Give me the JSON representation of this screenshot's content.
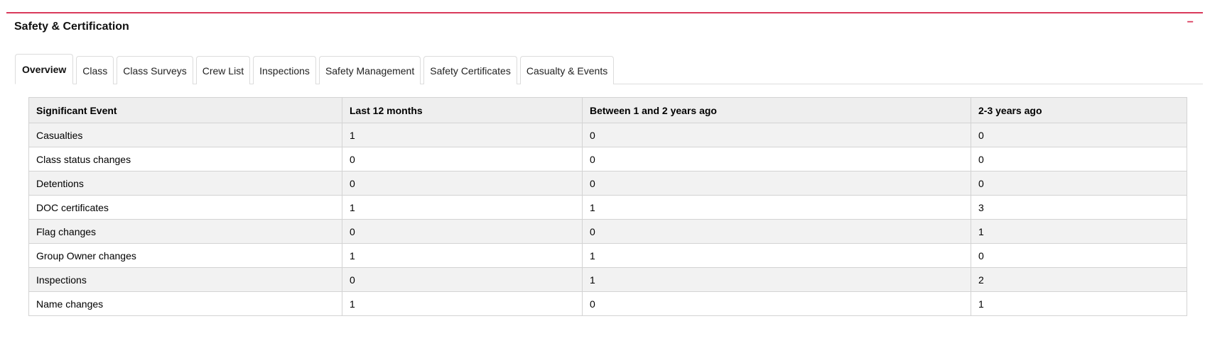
{
  "panel": {
    "title": "Safety & Certification",
    "collapse_label": "−",
    "accent_color": "#d9395b"
  },
  "tabs": [
    {
      "label": "Overview",
      "active": true
    },
    {
      "label": "Class",
      "active": false
    },
    {
      "label": "Class Surveys",
      "active": false
    },
    {
      "label": "Crew List",
      "active": false
    },
    {
      "label": "Inspections",
      "active": false
    },
    {
      "label": "Safety Management",
      "active": false
    },
    {
      "label": "Safety Certificates",
      "active": false
    },
    {
      "label": "Casualty & Events",
      "active": false
    }
  ],
  "table": {
    "headers": [
      "Significant Event",
      "Last 12 months",
      "Between 1 and 2 years ago",
      "2-3 years ago"
    ],
    "rows": [
      [
        "Casualties",
        "1",
        "0",
        "0"
      ],
      [
        "Class status changes",
        "0",
        "0",
        "0"
      ],
      [
        "Detentions",
        "0",
        "0",
        "0"
      ],
      [
        "DOC certificates",
        "1",
        "1",
        "3"
      ],
      [
        "Flag changes",
        "0",
        "0",
        "1"
      ],
      [
        "Group Owner changes",
        "1",
        "1",
        "0"
      ],
      [
        "Inspections",
        "0",
        "1",
        "2"
      ],
      [
        "Name changes",
        "1",
        "0",
        "1"
      ]
    ]
  }
}
